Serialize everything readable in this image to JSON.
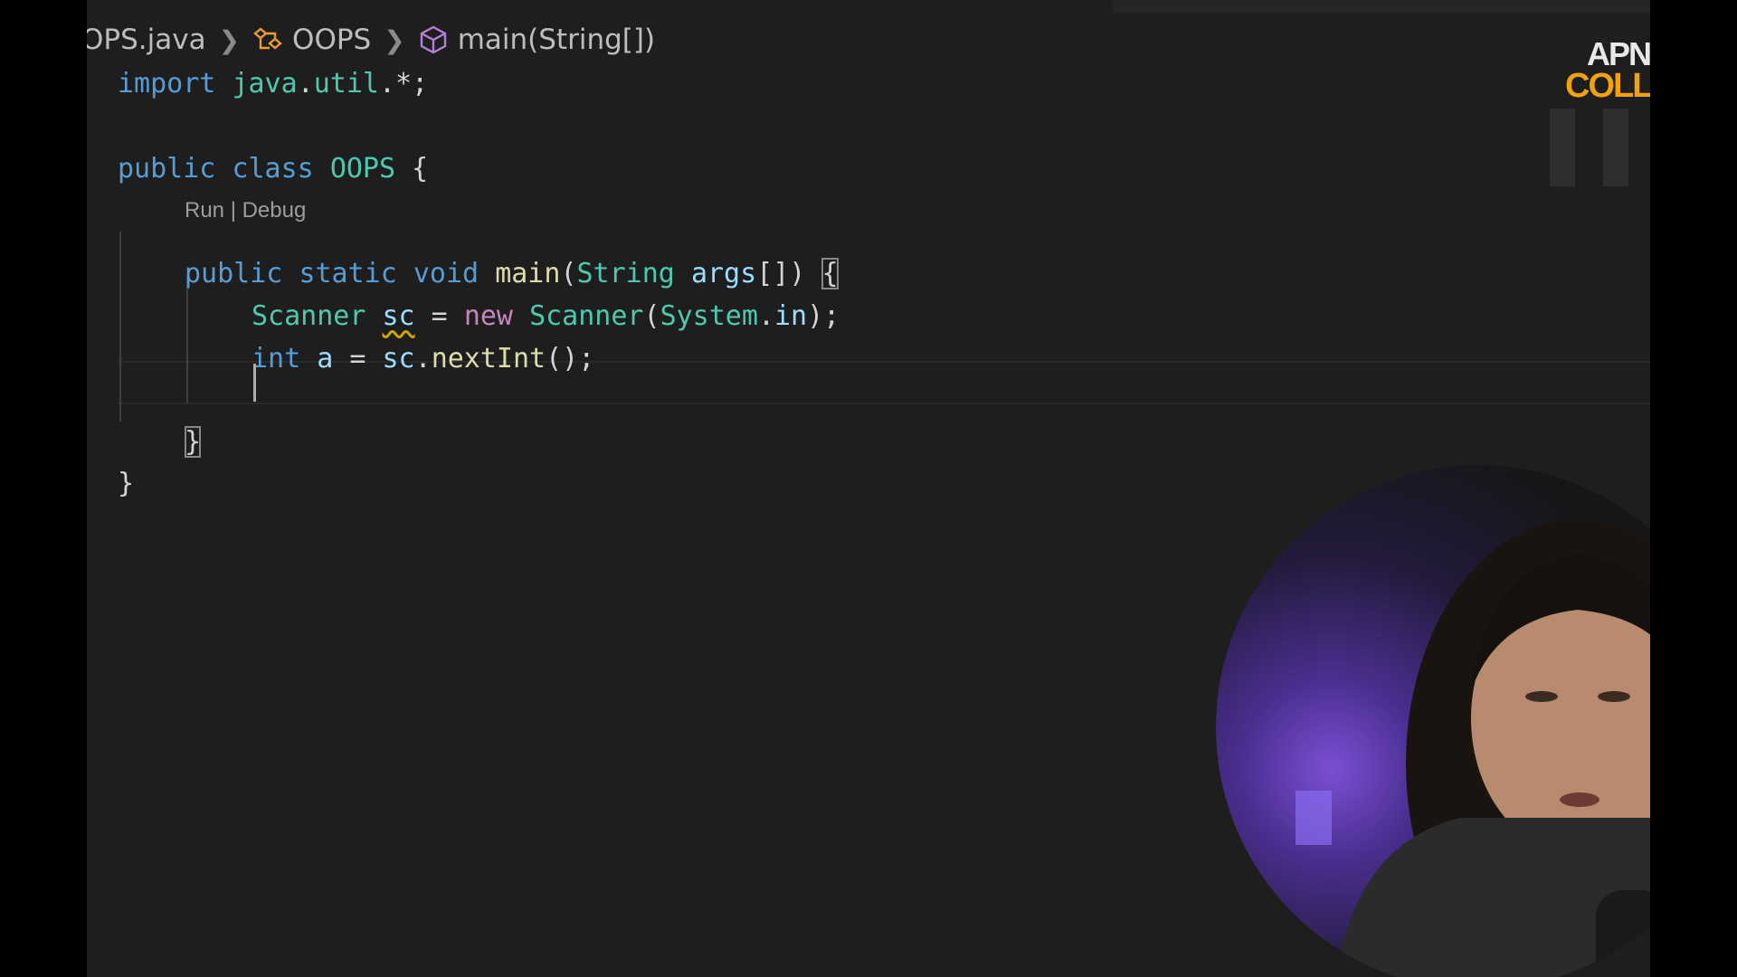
{
  "breadcrumb": {
    "file": "OPS.java",
    "class": "OOPS",
    "method": "main(String[])"
  },
  "codelens": "Run | Debug",
  "code": {
    "l1": {
      "kw": "import",
      "pkg1": "java",
      "dot1": ".",
      "pkg2": "util",
      "rest": ".*;"
    },
    "l3": {
      "kw1": "public",
      "kw2": "class",
      "name": "OOPS",
      "brace": "{"
    },
    "l4": {
      "kw1": "public",
      "kw2": "static",
      "kw3": "void",
      "fn": "main",
      "p1": "(",
      "type": "String",
      "arg": "args",
      "p2": "[]) ",
      "brace": "{"
    },
    "l5": {
      "type": "Scanner",
      "var": "sc",
      "eq": " = ",
      "kw": "new",
      "type2": "Scanner",
      "p1": "(",
      "type3": "System",
      "dot": ".",
      "field": "in",
      "end": ");"
    },
    "l6": {
      "kw": "int",
      "var": "a",
      "eq": " = ",
      "obj": "sc",
      "dot": ".",
      "fn": "nextInt",
      "end": "();"
    },
    "l8": {
      "brace": "}"
    },
    "l9": {
      "brace": "}"
    }
  },
  "logo": {
    "line1": "APN",
    "line2": "COLL"
  },
  "icons": [
    "chevron-right-icon",
    "class-icon",
    "method-cube-icon",
    "pause-icon"
  ],
  "colors": {
    "keyword": "#569cd6",
    "control": "#c586c0",
    "type": "#4ec9b0",
    "variable": "#9cdcfe",
    "function": "#dcdcaa",
    "logo_accent": "#f2a10f"
  }
}
